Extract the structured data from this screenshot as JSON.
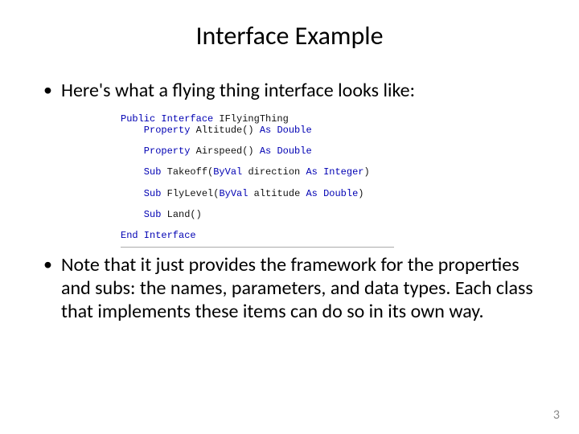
{
  "title": "Interface Example",
  "bullet1": "Here's what a flying thing interface looks like:",
  "bullet2": "Note that it just provides the framework for the properties and subs: the names, parameters, and data types. Each class that implements these items can do so in its own way.",
  "code": {
    "l1a": "Public Interface",
    "l1b": " IFlyingThing",
    "l2a": "    Property",
    "l2b": " Altitude() ",
    "l2c": "As Double",
    "l3a": "    Property",
    "l3b": " Airspeed() ",
    "l3c": "As Double",
    "l4a": "    Sub",
    "l4b": " Takeoff(",
    "l4c": "ByVal",
    "l4d": " direction ",
    "l4e": "As Integer",
    "l4f": ")",
    "l5a": "    Sub",
    "l5b": " FlyLevel(",
    "l5c": "ByVal",
    "l5d": " altitude ",
    "l5e": "As Double",
    "l5f": ")",
    "l6a": "    Sub",
    "l6b": " Land()",
    "l7a": "End Interface"
  },
  "pageNumber": "3"
}
